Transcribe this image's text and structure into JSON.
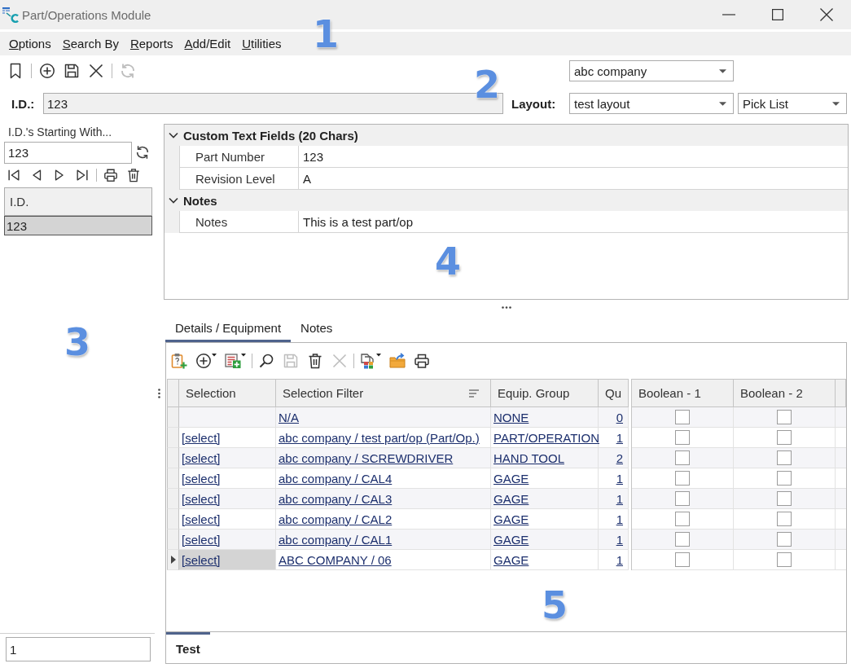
{
  "window": {
    "title": "Part/Operations Module"
  },
  "menu": {
    "items": [
      "Options",
      "Search By",
      "Reports",
      "Add/Edit",
      "Utilities"
    ],
    "callout": "1"
  },
  "toolbar": {
    "buttons": [
      {
        "disabled": false
      },
      {
        "disabled": false
      },
      {
        "disabled": false
      },
      {
        "disabled": false
      },
      {
        "disabled": true
      }
    ],
    "company": "abc company",
    "callout": "2"
  },
  "record": {
    "id_label": "I.D.:",
    "id_value": "123",
    "layout_label": "Layout:",
    "layout": "test layout",
    "view": "Pick List"
  },
  "sidebar": {
    "filter_label": "I.D.'s Starting With...",
    "filter_value": "123",
    "list_column": "I.D.",
    "list_rows": [
      {
        "id": "123",
        "selected": true
      }
    ],
    "footer_value": "1",
    "callout": "3"
  },
  "properties": {
    "categories": [
      {
        "title": "Custom Text Fields (20 Chars)",
        "expanded": true,
        "fields": [
          {
            "label": "Part Number",
            "value": "123"
          },
          {
            "label": "Revision Level",
            "value": "A"
          }
        ]
      },
      {
        "title": "Notes",
        "expanded": true,
        "fields": [
          {
            "label": "Notes",
            "value": "This is a test part/op"
          }
        ]
      }
    ],
    "callout": "4"
  },
  "tabs": [
    {
      "label": "Details / Equipment",
      "selected": true
    },
    {
      "label": "Notes",
      "selected": false
    }
  ],
  "grid": {
    "toolbar": [
      {
        "disabled": false,
        "dropdown": false
      },
      {
        "disabled": false,
        "dropdown": true
      },
      {
        "disabled": false,
        "dropdown": true
      },
      {
        "disabled": false,
        "dropdown": false
      },
      {
        "disabled": true,
        "dropdown": false
      },
      {
        "disabled": false,
        "dropdown": false
      },
      {
        "disabled": true,
        "dropdown": false
      },
      {
        "disabled": false,
        "dropdown": true
      },
      {
        "disabled": false,
        "dropdown": false
      },
      {
        "disabled": false,
        "dropdown": false
      }
    ],
    "columns": [
      {
        "label": "Selection",
        "sorted": false
      },
      {
        "label": "Selection Filter",
        "sorted": true
      },
      {
        "label": "Equip. Group",
        "sorted": false
      },
      {
        "label": "Qu",
        "sorted": false
      },
      {
        "label": "Boolean - 1",
        "sorted": false
      },
      {
        "label": "Boolean - 2",
        "sorted": false
      }
    ],
    "rows": [
      {
        "filter": "N/A",
        "group": "NONE",
        "qty": "0",
        "boolean_1": false,
        "boolean_2": false,
        "current": false
      },
      {
        "selection": "[select]",
        "filter": "abc company / test part/op (Part/Op.)",
        "group": "PART/OPERATION",
        "qty": "1",
        "boolean_1": false,
        "boolean_2": false,
        "current": false
      },
      {
        "selection": "[select]",
        "filter": "abc company / SCREWDRIVER",
        "group": "HAND TOOL",
        "qty": "2",
        "boolean_1": false,
        "boolean_2": false,
        "current": false
      },
      {
        "selection": "[select]",
        "filter": "abc company / CAL4",
        "group": "GAGE",
        "qty": "1",
        "boolean_1": false,
        "boolean_2": false,
        "current": false
      },
      {
        "selection": "[select]",
        "filter": "abc company / CAL3",
        "group": "GAGE",
        "qty": "1",
        "boolean_1": false,
        "boolean_2": false,
        "current": false
      },
      {
        "selection": "[select]",
        "filter": "abc company / CAL2",
        "group": "GAGE",
        "qty": "1",
        "boolean_1": false,
        "boolean_2": false,
        "current": false
      },
      {
        "selection": "[select]",
        "filter": "abc company / CAL1",
        "group": "GAGE",
        "qty": "1",
        "boolean_1": false,
        "boolean_2": false,
        "current": false
      },
      {
        "selection": "[select]",
        "filter": "ABC COMPANY / 06",
        "group": "GAGE",
        "qty": "1",
        "boolean_1": false,
        "boolean_2": false,
        "current": true
      }
    ],
    "callout": "5"
  },
  "bottom_tabs": [
    {
      "label": "Test",
      "selected": true
    }
  ]
}
